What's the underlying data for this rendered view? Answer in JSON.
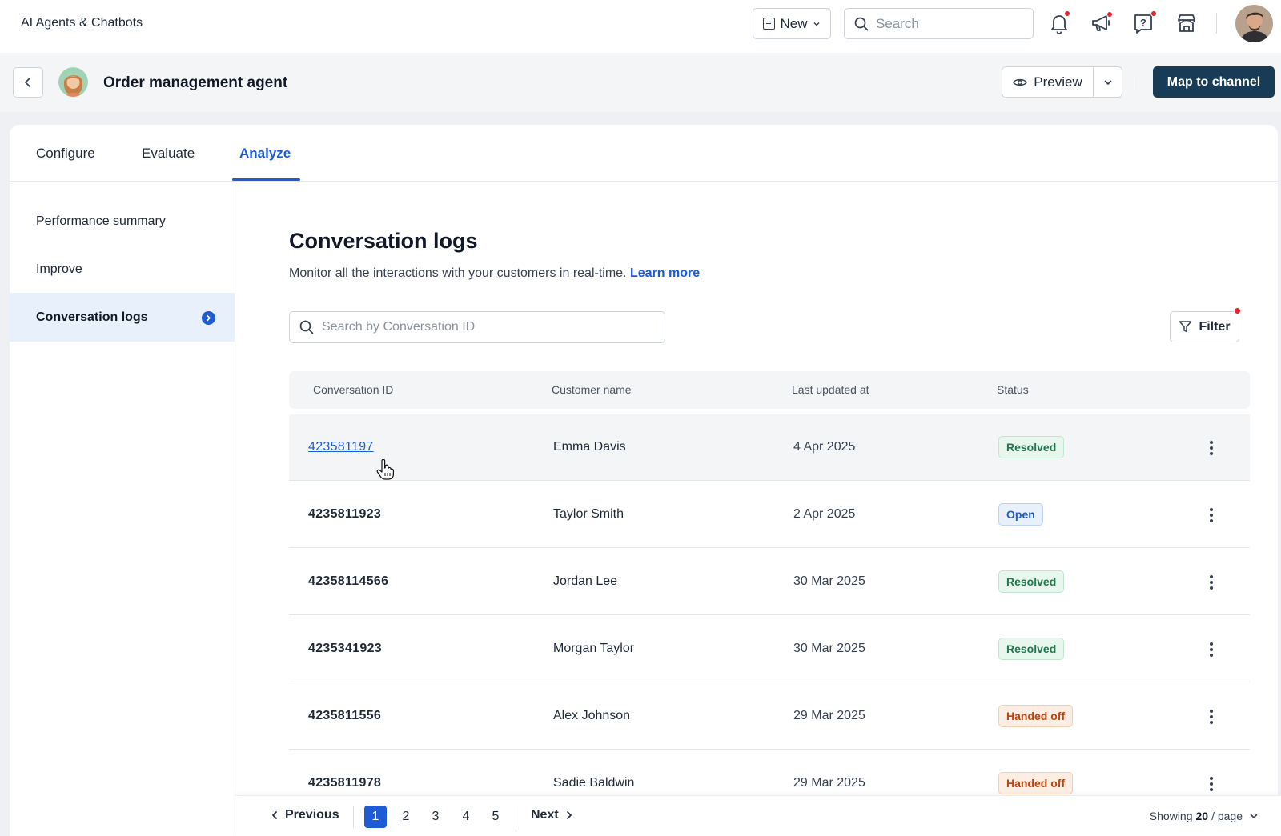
{
  "app": {
    "title": "AI Agents & Chatbots"
  },
  "topbar": {
    "new_label": "New",
    "search_placeholder": "Search"
  },
  "agent": {
    "name": "Order management agent",
    "preview_label": "Preview",
    "map_label": "Map to channel"
  },
  "tabs": [
    {
      "label": "Configure"
    },
    {
      "label": "Evaluate"
    },
    {
      "label": "Analyze"
    }
  ],
  "sidebar": {
    "items": [
      {
        "label": "Performance summary"
      },
      {
        "label": "Improve"
      },
      {
        "label": "Conversation logs"
      }
    ]
  },
  "page": {
    "title": "Conversation logs",
    "description": "Monitor all the interactions with your customers in real-time.",
    "learn_more": "Learn more",
    "search_placeholder": "Search by Conversation ID",
    "filter_label": "Filter"
  },
  "table": {
    "columns": [
      "Conversation ID",
      "Customer name",
      "Last updated at",
      "Status"
    ],
    "rows": [
      {
        "id": "423581197",
        "name": "Emma Davis",
        "updated": "4 Apr 2025",
        "status": "Resolved"
      },
      {
        "id": "4235811923",
        "name": "Taylor Smith",
        "updated": "2 Apr 2025",
        "status": "Open"
      },
      {
        "id": "42358114566",
        "name": "Jordan Lee",
        "updated": "30 Mar 2025",
        "status": "Resolved"
      },
      {
        "id": "4235341923",
        "name": "Morgan Taylor",
        "updated": "30 Mar 2025",
        "status": "Resolved"
      },
      {
        "id": "4235811556",
        "name": "Alex Johnson",
        "updated": "29 Mar 2025",
        "status": "Handed off"
      },
      {
        "id": "4235811978",
        "name": "Sadie Baldwin",
        "updated": "29 Mar 2025",
        "status": "Handed off"
      }
    ]
  },
  "pagination": {
    "previous": "Previous",
    "next": "Next",
    "pages": [
      "1",
      "2",
      "3",
      "4",
      "5"
    ],
    "current": "1",
    "showing_prefix": "Showing",
    "page_size": "20",
    "showing_suffix": "/ page"
  },
  "colors": {
    "accent": "#1d5bd7",
    "primary_button": "#183b56",
    "resolved": "#1f7a4a",
    "open": "#1d5bd7",
    "handed_off": "#c2410c",
    "notification_dot": "#e5232b"
  },
  "icons": {
    "topbar": [
      "bell-icon",
      "megaphone-icon",
      "help-icon",
      "store-icon"
    ]
  }
}
